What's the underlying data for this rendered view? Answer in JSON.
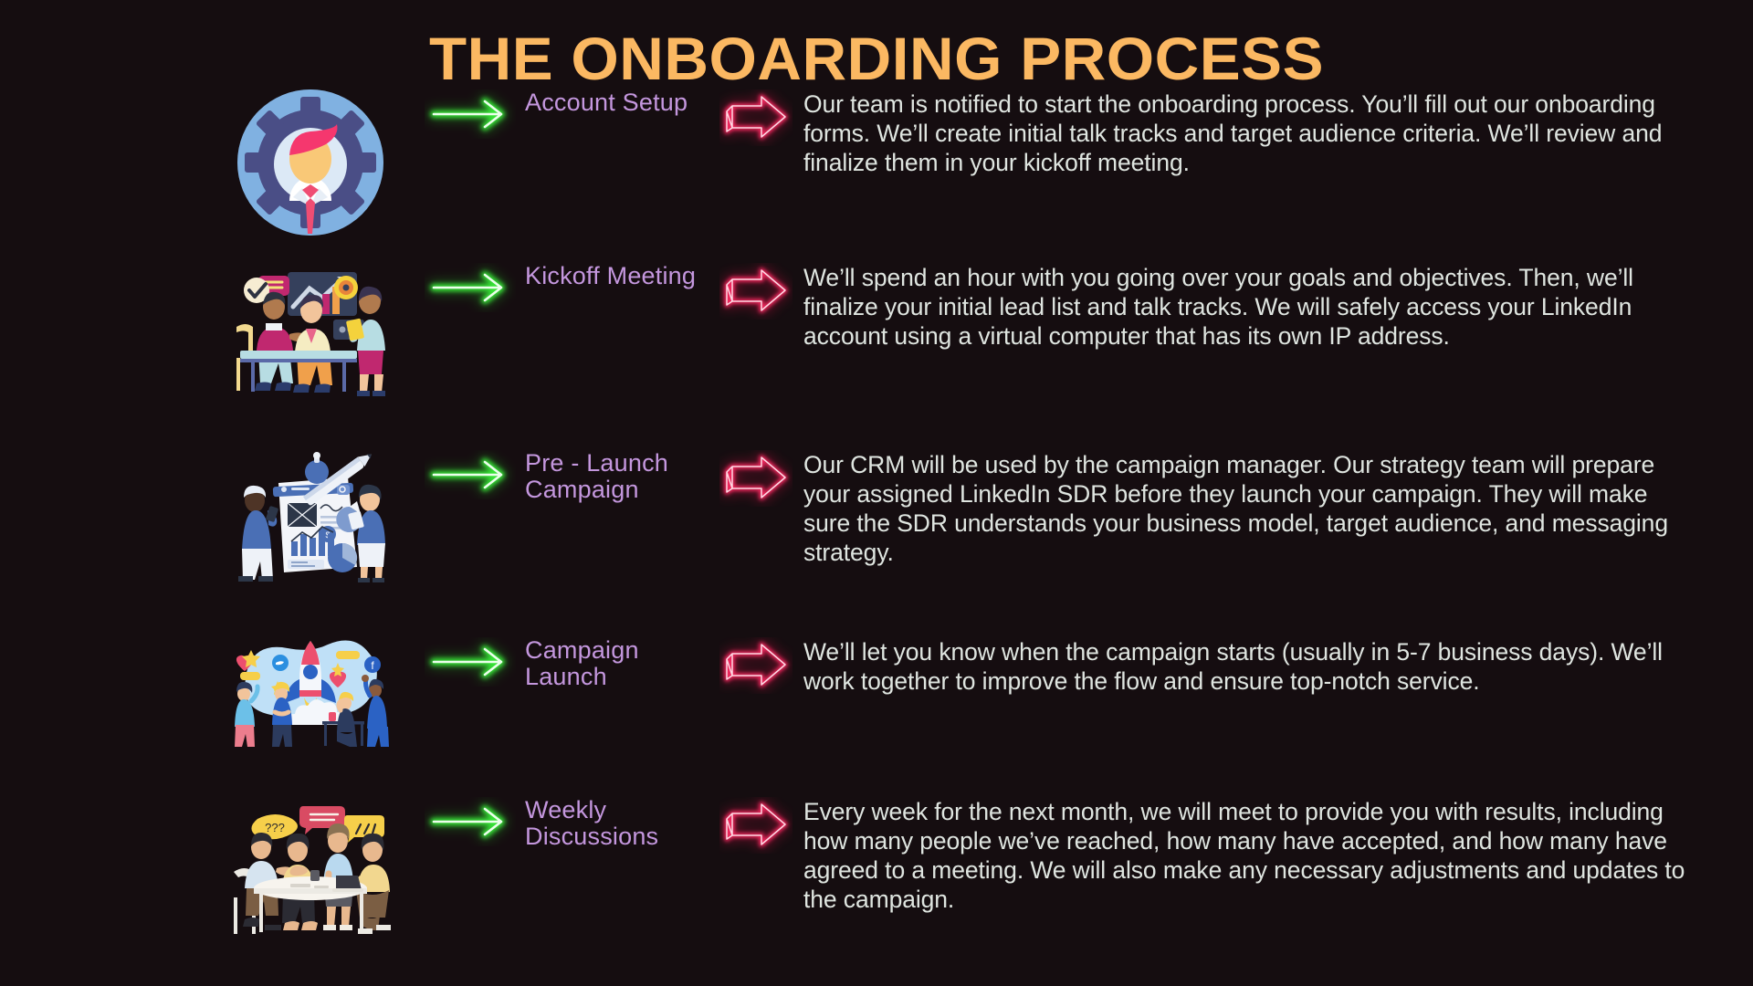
{
  "page": {
    "title": "THE ONBOARDING PROCESS",
    "background_color": "#150d10",
    "title_color": "#fbb862",
    "label_color": "#c497de",
    "body_color": "#dfe5e0",
    "green_arrow_color": "#3dff3d",
    "pink_arrow_color": "#ff2a63"
  },
  "steps": [
    {
      "illustration": "account-setup-gear-avatar-illustration",
      "green_arrow": "green-neon-arrow-icon",
      "label": "Account Setup",
      "pink_arrow": "pink-neon-block-arrow-icon",
      "body": "Our team is notified to start the onboarding process. You’ll fill out our onboarding forms. We’ll create initial talk tracks and target audience criteria. We’ll review and finalize them in your kickoff meeting."
    },
    {
      "illustration": "kickoff-meeting-team-illustration",
      "green_arrow": "green-neon-arrow-icon",
      "label": "Kickoff Meeting",
      "pink_arrow": "pink-neon-block-arrow-icon",
      "body": "We’ll spend an hour with you going over your goals and objectives. Then, we’ll finalize your initial lead list and talk tracks. We will safely access your LinkedIn account using a virtual computer that has its own IP address."
    },
    {
      "illustration": "pre-launch-campaign-planning-illustration",
      "green_arrow": "green-neon-arrow-icon",
      "label": "Pre - Launch\nCampaign",
      "pink_arrow": "pink-neon-block-arrow-icon",
      "body": "Our CRM will be used by the campaign manager. Our strategy team will prepare your assigned LinkedIn SDR before they launch your campaign. They will make sure the SDR understands your business model, target audience, and messaging strategy."
    },
    {
      "illustration": "campaign-launch-rocket-illustration",
      "green_arrow": "green-neon-arrow-icon",
      "label": "Campaign\nLaunch",
      "pink_arrow": "pink-neon-block-arrow-icon",
      "body": "We’ll let you know when the campaign starts (usually in 5-7 business days). We’ll work together to improve the flow and ensure top-notch service."
    },
    {
      "illustration": "weekly-discussions-roundtable-illustration",
      "green_arrow": "green-neon-arrow-icon",
      "label": "Weekly\nDiscussions",
      "pink_arrow": "pink-neon-block-arrow-icon",
      "body": "Every week for the next  month, we will meet to provide you with results, including how many people we’ve reached, how many have accepted, and how many have agreed to a meeting. We will also make any necessary adjustments and updates to the campaign."
    }
  ]
}
